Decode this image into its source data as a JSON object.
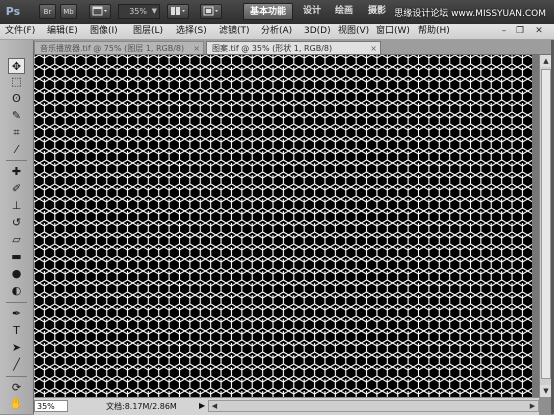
{
  "app": {
    "logo": "Ps",
    "bridge_label": "Br",
    "minibridge_label": "Mb",
    "zoom_value": "35%",
    "workspaces": [
      "基本功能",
      "设计",
      "绘画",
      "摄影"
    ],
    "watermark": "思缘设计论坛 www.MISSYUAN.COM"
  },
  "menu": {
    "items": [
      "文件(F)",
      "编辑(E)",
      "图像(I)",
      "图层(L)",
      "选择(S)",
      "滤镜(T)",
      "分析(A)",
      "3D(D)",
      "视图(V)",
      "窗口(W)",
      "帮助(H)"
    ],
    "minimize": "–",
    "restore": "❐",
    "close": "✕"
  },
  "tabs": [
    {
      "title": "音乐播放器.tif @ 75% (图层 1, RGB/8)",
      "close": "×"
    },
    {
      "title": "图案.tif @ 35% (形状 1, RGB/8)",
      "close": "×"
    }
  ],
  "status": {
    "zoom": "35%",
    "doc_info": "文档:8.17M/2.86M",
    "arrow": "▶"
  },
  "colors": {
    "canvas_bg": "#000000",
    "pattern_stroke": "#ffffff",
    "appbar": "#3a3a3a"
  },
  "icons": {
    "tools": [
      "move-icon",
      "marquee-icon",
      "lasso-icon",
      "quick-select-icon",
      "crop-icon",
      "eyedropper-icon",
      "spot-heal-icon",
      "brush-icon",
      "clone-stamp-icon",
      "history-brush-icon",
      "eraser-icon",
      "gradient-icon",
      "blur-icon",
      "dodge-icon",
      "pen-icon",
      "type-icon",
      "path-select-icon",
      "line-icon",
      "3d-rotate-icon",
      "3d-camera-icon",
      "hand-icon"
    ]
  }
}
